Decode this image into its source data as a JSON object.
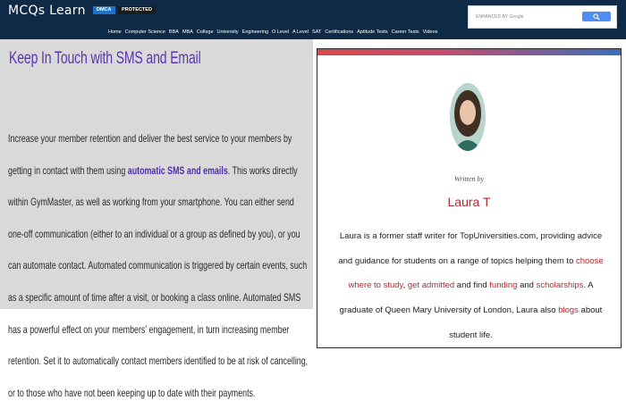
{
  "header": {
    "logo": "MCQs Learn",
    "badges": [
      "DMCA",
      "PROTECTED"
    ],
    "search": {
      "brand_label": "ENHANCED BY Google",
      "button_icon": "search-icon"
    },
    "nav": [
      "Home",
      "Computer Science",
      "BBA",
      "MBA",
      "College",
      "University",
      "Engineering",
      "O Level",
      "A Level",
      "SAT",
      "Certifications",
      "Aptitude Tests",
      "Career Tests",
      "Videos"
    ]
  },
  "article": {
    "title": "Keep In Touch with SMS and Email",
    "body_parts": {
      "before_highlight": "Increase your member retention and deliver the best service to your members by getting in contact with them using ",
      "highlight": "automatic SMS and emails",
      "after_highlight": ". This works directly within GymMaster, as well as working from your smartphone. You can either send one-off communication (either to an individual or a group as defined by you), or you can automate contact. Automated communication is triggered by certain events, such as a specific amount of time after a visit, or booking a class online. Automated SMS has a powerful effect on your members' engagement, in turn increasing member retention. Set it to automatically contact members identified to be at risk of cancelling, or to those who have not been keeping up to date with their payments."
    }
  },
  "author_card": {
    "written_by": "Written by",
    "name": "Laura T",
    "bio": {
      "p1": "Laura is a former staff writer for TopUniversities.com, providing advice and guidance for students on a range of topics helping them to ",
      "link1": "choose where to study",
      "p2": ", ",
      "link2": "get admitted",
      "p3": " and find ",
      "link3": "funding",
      "p4": " and ",
      "link4": "scholarships",
      "p5": ". A graduate of Queen Mary University of London, Laura also ",
      "link5": "blogs",
      "p6": " about student life."
    },
    "colors": {
      "accent": "#b4282d",
      "stripe_left": "#d24a4a",
      "stripe_right": "#3b6db8"
    }
  },
  "colors": {
    "header_bg": "#0e2a46",
    "title": "#5a35b5",
    "highlight": "#4b2fb0"
  }
}
